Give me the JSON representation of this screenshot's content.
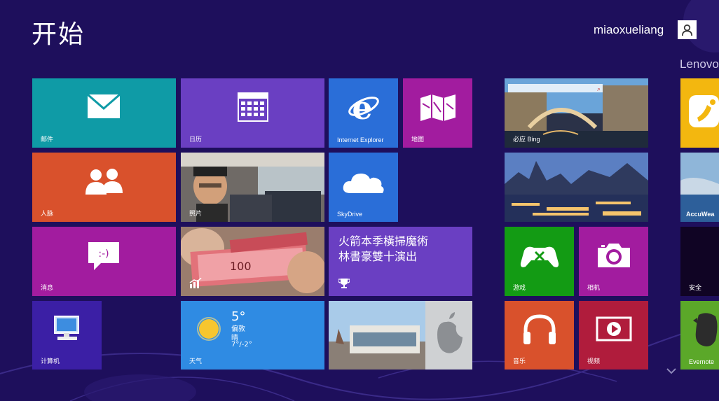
{
  "header": {
    "title": "开始",
    "user_name": "miaoxueliang"
  },
  "group_label": "Lenovo",
  "tiles": {
    "mail": {
      "label": "邮件",
      "color": "#0f9ba6"
    },
    "calendar": {
      "label": "日历",
      "color": "#6a3fc2"
    },
    "ie": {
      "label": "Internet Explorer",
      "color": "#2a6ed8"
    },
    "maps": {
      "label": "地图",
      "color": "#a21c9f"
    },
    "bing": {
      "label": "必应 Bing"
    },
    "people": {
      "label": "人脉",
      "color": "#d9512c"
    },
    "photos": {
      "label": "照片"
    },
    "skydrive": {
      "label": "SkyDrive",
      "color": "#2a6ed8"
    },
    "accuweather": {
      "label": "AccuWea",
      "color": "#1a73c9"
    },
    "messaging": {
      "label": "消息",
      "color": "#a21c9f"
    },
    "news": {
      "text_line1": "火箭本季橫掃魔術",
      "text_line2": "林書豪雙十演出",
      "color": "#6a3fc2"
    },
    "games": {
      "label": "游戏",
      "color": "#139b14"
    },
    "camera": {
      "label": "相机",
      "color": "#a21c9f"
    },
    "security": {
      "label": "安全",
      "color": "#100424"
    },
    "computer": {
      "label": "计算机",
      "color": "#3b1fa5"
    },
    "weather": {
      "label": "天气",
      "temp": "5°",
      "city": "偏敦",
      "condition": "晴",
      "range": "7°/-2°",
      "color": "#2f8be3"
    },
    "music": {
      "label": "音乐",
      "color": "#d9512c"
    },
    "video": {
      "label": "视频",
      "color": "#b01c3c"
    },
    "evernote": {
      "label": "Evernote",
      "color": "#5ba829"
    }
  }
}
